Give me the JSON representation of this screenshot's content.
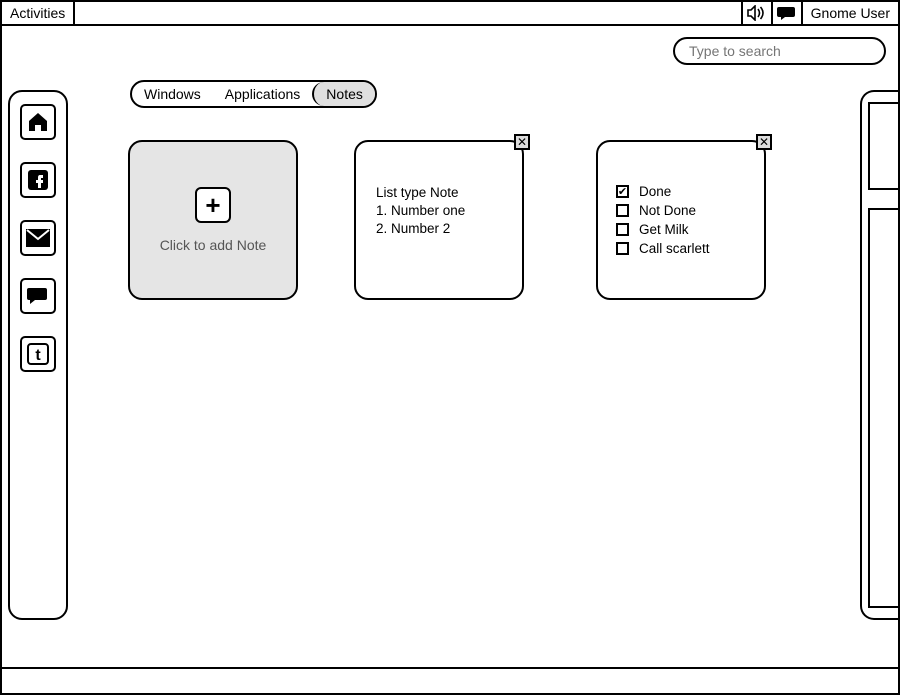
{
  "topbar": {
    "activities": "Activities",
    "user": "Gnome User"
  },
  "search": {
    "placeholder": "Type to search"
  },
  "tabs": {
    "items": [
      {
        "label": "Windows"
      },
      {
        "label": "Applications"
      },
      {
        "label": "Notes"
      }
    ],
    "selected_index": 2
  },
  "add_note": {
    "caption": "Click to add Note"
  },
  "notes": [
    {
      "type": "list",
      "title": "List type Note",
      "items": [
        "Number one",
        "Number 2"
      ]
    },
    {
      "type": "checklist",
      "items": [
        {
          "label": "Done",
          "checked": true
        },
        {
          "label": "Not Done",
          "checked": false
        },
        {
          "label": "Get Milk",
          "checked": false
        },
        {
          "label": "Call scarlett",
          "checked": false
        }
      ]
    }
  ],
  "dock": [
    "home",
    "facebook",
    "mail",
    "chat",
    "twitter"
  ]
}
